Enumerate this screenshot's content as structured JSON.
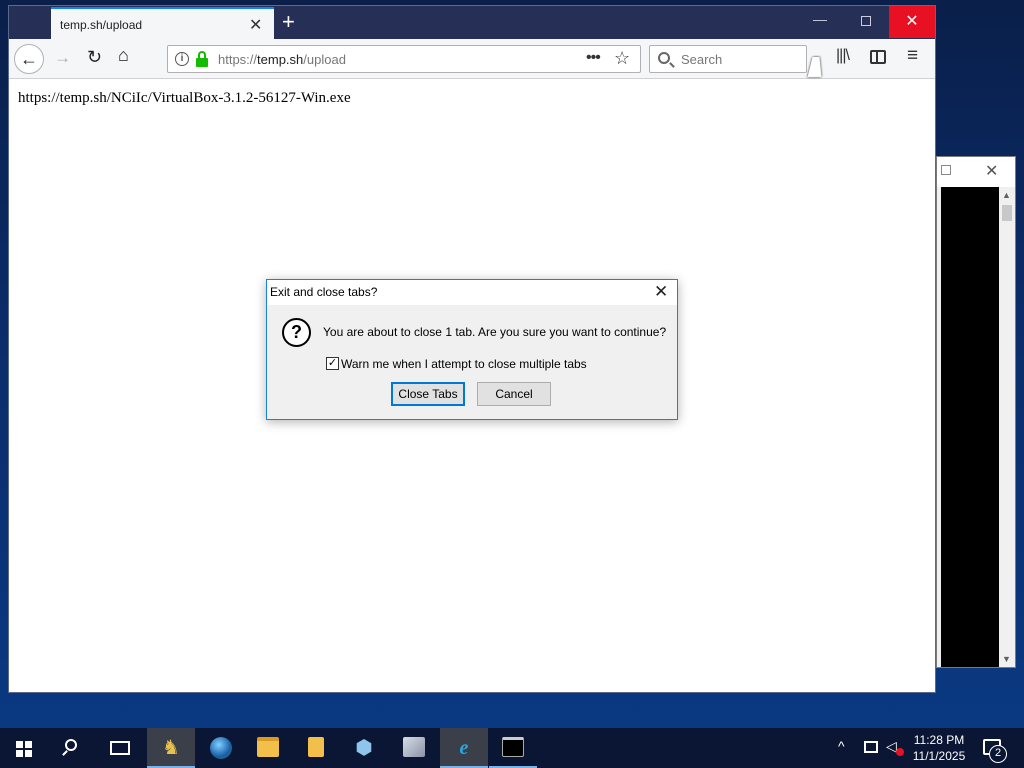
{
  "browser": {
    "tab_title": "temp.sh/upload",
    "url_scheme": "https://",
    "url_host": "temp.sh",
    "url_path": "/upload",
    "search_placeholder": "Search",
    "accent_color": "#0a84ff",
    "lock_color": "#12bc00"
  },
  "page": {
    "link_text": "https://temp.sh/NCiIc/VirtualBox-3.1.2-56127-Win.exe"
  },
  "dialog": {
    "title": "Exit and close tabs?",
    "message": "You are about to close 1 tab. Are you sure you want to continue?",
    "checkbox_label": "Warn me when I attempt to close multiple tabs",
    "checkbox_checked": true,
    "confirm_label": "Close Tabs",
    "cancel_label": "Cancel",
    "icon": "question-icon"
  },
  "taskbar": {
    "apps": [
      "start",
      "search",
      "task-view",
      "app-dragon",
      "app-globe",
      "file-explorer",
      "app-folder-download",
      "app-3d-box",
      "app-server",
      "internet-explorer",
      "command-prompt"
    ],
    "active_app": "internet-explorer",
    "time": "11:28 PM",
    "date": "11/1/2025",
    "notification_count": "2"
  }
}
